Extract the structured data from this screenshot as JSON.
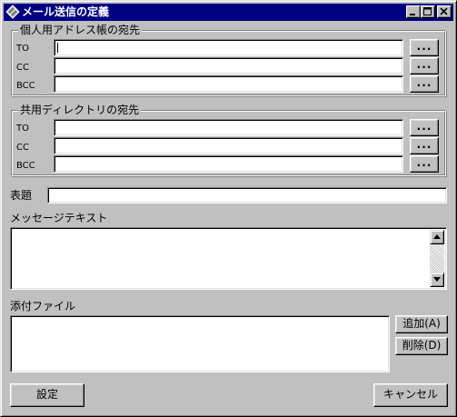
{
  "window": {
    "title": "メール送信の定義"
  },
  "personal_group": {
    "legend": "個人用アドレス帳の宛先",
    "rows": [
      {
        "label": "TO",
        "value": ""
      },
      {
        "label": "CC",
        "value": ""
      },
      {
        "label": "BCC",
        "value": ""
      }
    ],
    "browse_label": "..."
  },
  "shared_group": {
    "legend": "共用ディレクトリの宛先",
    "rows": [
      {
        "label": "TO",
        "value": ""
      },
      {
        "label": "CC",
        "value": ""
      },
      {
        "label": "BCC",
        "value": ""
      }
    ],
    "browse_label": "..."
  },
  "subject": {
    "label": "表題",
    "value": ""
  },
  "message": {
    "label": "メッセージテキスト",
    "value": ""
  },
  "attachments": {
    "label": "添付ファイル",
    "add_label": "追加(A)",
    "delete_label": "削除(D)"
  },
  "footer": {
    "ok_label": "設定",
    "cancel_label": "キャンセル"
  }
}
